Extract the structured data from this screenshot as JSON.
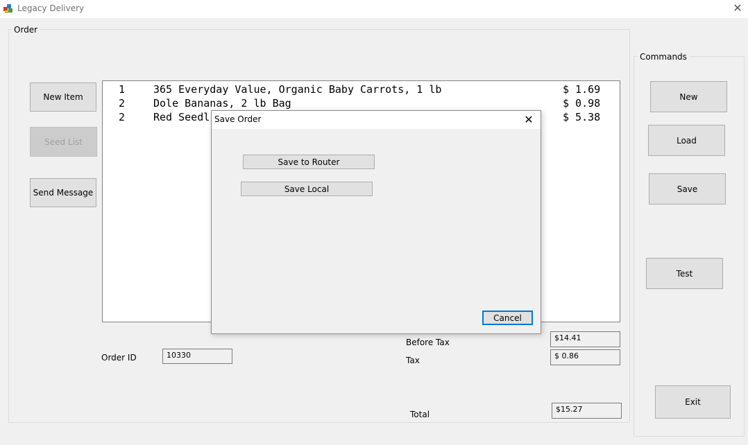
{
  "window": {
    "title": "Legacy Delivery",
    "close_glyph": "✕"
  },
  "order_group": {
    "label": "Order",
    "buttons": {
      "new_item": "New Item",
      "seed_list": "Seed List",
      "send_message": "Send Message"
    },
    "items": [
      {
        "qty": "1",
        "name": "365 Everyday Value, Organic Baby Carrots, 1 lb",
        "price": "$ 1.69"
      },
      {
        "qty": "2",
        "name": "Dole Bananas, 2 lb Bag",
        "price": "$ 0.98"
      },
      {
        "qty": "2",
        "name": "Red Seedl",
        "price": "$ 5.38"
      }
    ],
    "order_id_label": "Order ID",
    "order_id_value": "10330",
    "before_tax_label": "Before Tax",
    "before_tax_value": "$14.41",
    "tax_label": "Tax",
    "tax_value": "$ 0.86",
    "total_label": "Total",
    "total_value": "$15.27"
  },
  "commands_group": {
    "label": "Commands",
    "buttons": {
      "new": "New",
      "load": "Load",
      "save": "Save",
      "test": "Test",
      "exit": "Exit"
    }
  },
  "save_dialog": {
    "title": "Save Order",
    "close_glyph": "✕",
    "save_router": "Save to Router",
    "save_local": "Save Local",
    "cancel": "Cancel"
  },
  "colors": {
    "window_bg": "#f0f0f0",
    "button_bg": "#e1e1e1",
    "focus_border": "#0078d7"
  },
  "icons": {
    "app": "app-icon"
  }
}
